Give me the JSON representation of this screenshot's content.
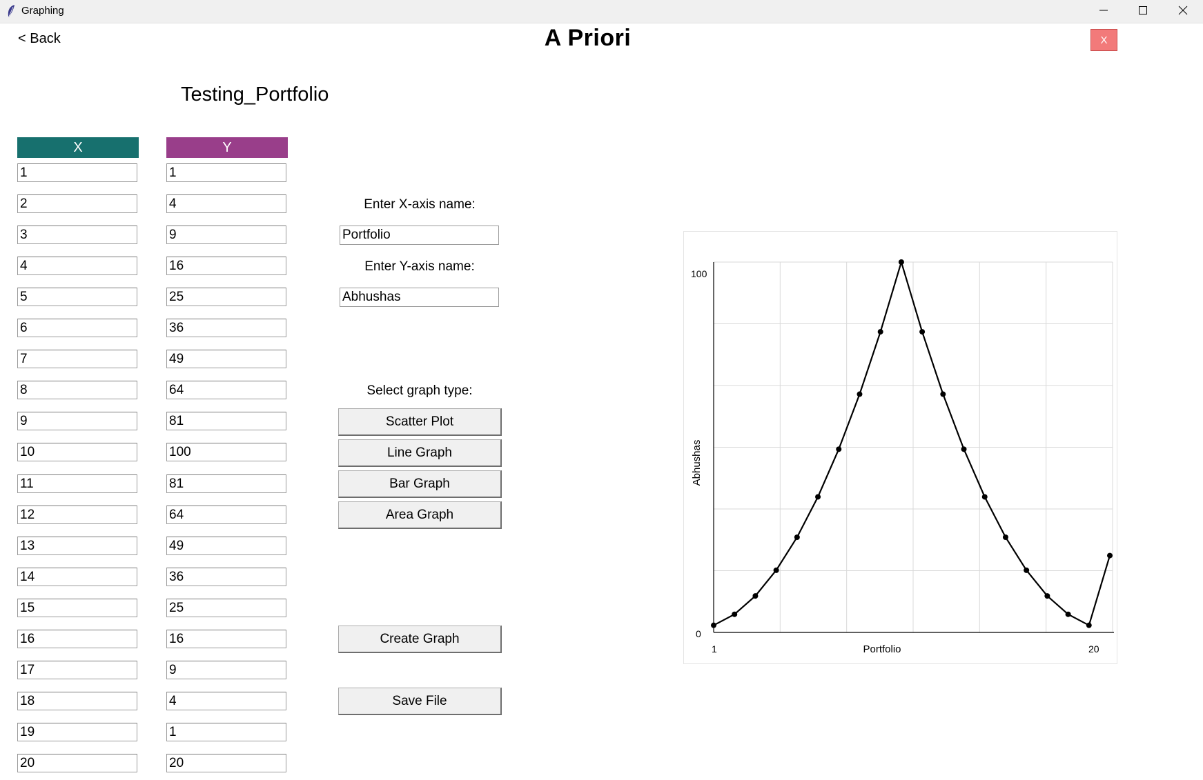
{
  "window": {
    "title": "Graphing",
    "controls": [
      "minimize-icon",
      "maximize-icon",
      "close-icon"
    ]
  },
  "header": {
    "back_label": "< Back",
    "app_title": "A Priori",
    "close_label": "X"
  },
  "portfolio": {
    "name": "Testing_Portfolio"
  },
  "table": {
    "x_header": "X",
    "y_header": "Y",
    "x_values": [
      "1",
      "2",
      "3",
      "4",
      "5",
      "6",
      "7",
      "8",
      "9",
      "10",
      "11",
      "12",
      "13",
      "14",
      "15",
      "16",
      "17",
      "18",
      "19",
      "20"
    ],
    "y_values": [
      "1",
      "4",
      "9",
      "16",
      "25",
      "36",
      "49",
      "64",
      "81",
      "100",
      "81",
      "64",
      "49",
      "36",
      "25",
      "16",
      "9",
      "4",
      "1",
      "20"
    ],
    "x_color": "#17706e",
    "y_color": "#993e8a"
  },
  "controls": {
    "x_axis_label": "Enter X-axis name:",
    "x_axis_value": "Portfolio",
    "y_axis_label": "Enter Y-axis name:",
    "y_axis_value": "Abhushas",
    "graph_type_label": "Select graph type:",
    "scatter_label": "Scatter Plot",
    "line_label": "Line Graph",
    "bar_label": "Bar Graph",
    "area_label": "Area Graph",
    "create_label": "Create Graph",
    "save_label": "Save File"
  },
  "chart_data": {
    "type": "line",
    "x": [
      1,
      2,
      3,
      4,
      5,
      6,
      7,
      8,
      9,
      10,
      11,
      12,
      13,
      14,
      15,
      16,
      17,
      18,
      19,
      20
    ],
    "series": [
      {
        "values": [
          1,
          4,
          9,
          16,
          25,
          36,
          49,
          64,
          81,
          100,
          81,
          64,
          49,
          36,
          25,
          16,
          9,
          4,
          1,
          20
        ]
      }
    ],
    "xlabel": "Portfolio",
    "ylabel": "Abhushas",
    "x_ticks": [
      "1",
      "20"
    ],
    "y_ticks": [
      "0",
      "100"
    ],
    "xlim": [
      1,
      20
    ],
    "ylim": [
      0,
      100
    ],
    "grid": true,
    "markers": true,
    "line_color": "#000000"
  }
}
